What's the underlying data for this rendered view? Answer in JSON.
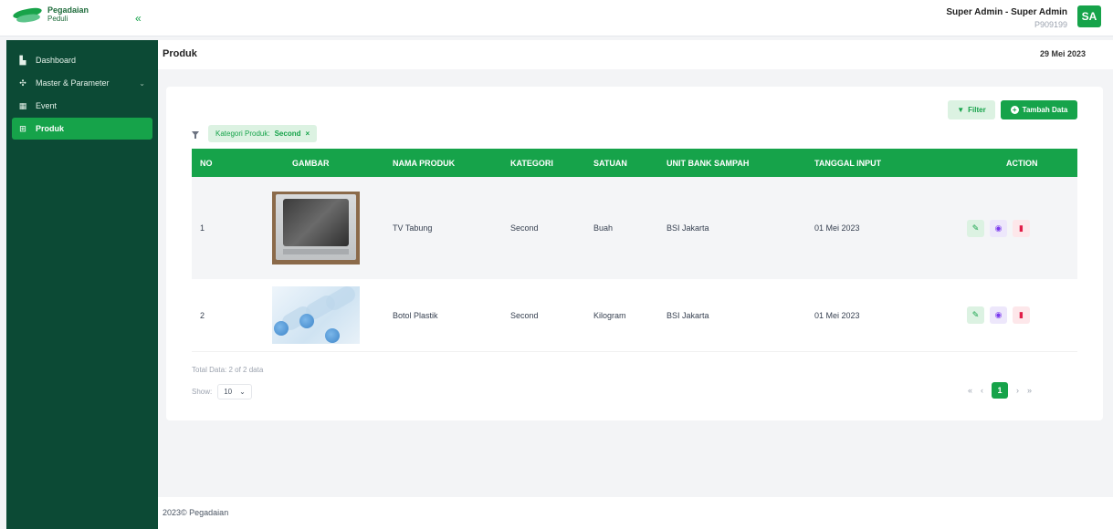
{
  "app": {
    "logo_title": "Pegadaian",
    "logo_subtitle": "Peduli",
    "collapse_icon": "double-chevron-left"
  },
  "user": {
    "name": "Super Admin - Super Admin",
    "id": "P909199",
    "initials": "SA"
  },
  "sidebar": {
    "items": [
      {
        "label": "Dashboard",
        "icon": "dashboard-icon",
        "active": false
      },
      {
        "label": "Master & Parameter",
        "icon": "parameter-icon",
        "active": false,
        "expandable": true
      },
      {
        "label": "Event",
        "icon": "calendar-icon",
        "active": false
      },
      {
        "label": "Produk",
        "icon": "grid-icon",
        "active": true
      }
    ]
  },
  "page": {
    "title": "Produk",
    "date": "29 Mei 2023"
  },
  "toolbar": {
    "filter_label": "Filter",
    "add_label": "Tambah Data"
  },
  "active_filter": {
    "label": "Kategori Produk:",
    "value": "Second",
    "remove": "×"
  },
  "table": {
    "columns": [
      "NO",
      "GAMBAR",
      "NAMA PRODUK",
      "KATEGORI",
      "SATUAN",
      "UNIT BANK SAMPAH",
      "TANGGAL INPUT",
      "ACTION"
    ],
    "rows": [
      {
        "no": "1",
        "image": "tv-tabung-photo",
        "name": "TV Tabung",
        "kategori": "Second",
        "satuan": "Buah",
        "unit": "BSI Jakarta",
        "tanggal": "01 Mei 2023"
      },
      {
        "no": "2",
        "image": "botol-plastik-photo",
        "name": "Botol Plastik",
        "kategori": "Second",
        "satuan": "Kilogram",
        "unit": "BSI Jakarta",
        "tanggal": "01 Mei 2023"
      }
    ],
    "actions": [
      "edit-icon",
      "view-icon",
      "delete-icon"
    ]
  },
  "summary": {
    "total": "Total Data: 2 of 2 data",
    "show_label": "Show:",
    "show_value": "10"
  },
  "pagination": {
    "first": "«",
    "prev": "‹",
    "current": "1",
    "next": "›",
    "last": "»"
  },
  "footer": {
    "text": "2023© Pegadaian"
  },
  "colors": {
    "primary": "#16a34a",
    "sidebar": "#0c4a35"
  }
}
